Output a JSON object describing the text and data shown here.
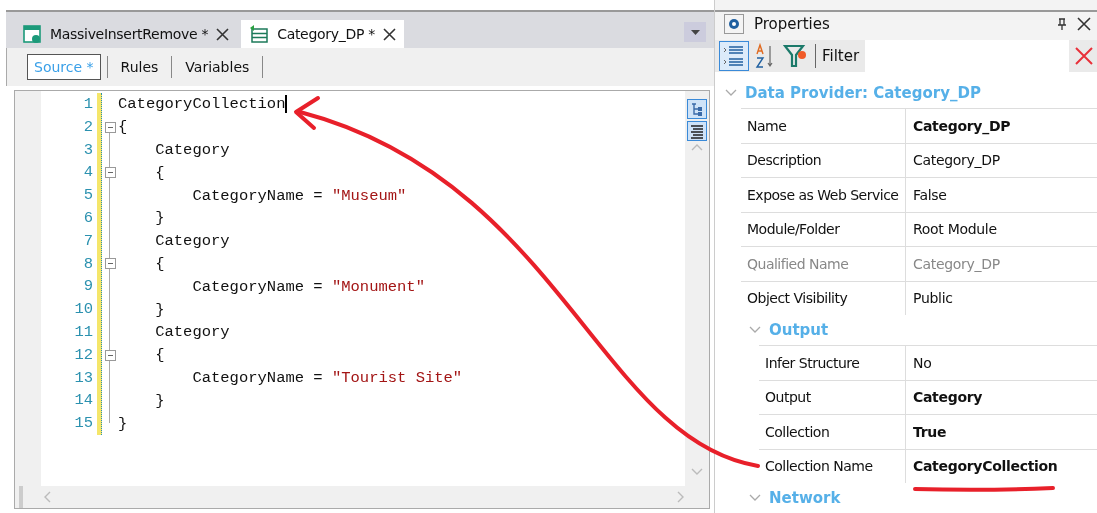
{
  "document_tabs": [
    {
      "label": "MassiveInsertRemove *",
      "selected": false,
      "kind": "procedure"
    },
    {
      "label": "Category_DP *",
      "selected": true,
      "kind": "dataprovider"
    }
  ],
  "sub_tabs": [
    {
      "label": "Source *",
      "selected": true
    },
    {
      "label": "Rules",
      "selected": false
    },
    {
      "label": "Variables",
      "selected": false
    }
  ],
  "editor": {
    "lines": [
      {
        "number": "1",
        "collapsible": false,
        "tokens": [
          {
            "kind": "plain",
            "text": "CategoryCollection"
          }
        ],
        "caret": true
      },
      {
        "number": "2",
        "collapsible": true,
        "tokens": [
          {
            "kind": "plain",
            "text": "{"
          }
        ],
        "caret": false
      },
      {
        "number": "3",
        "collapsible": false,
        "tokens": [
          {
            "kind": "plain",
            "text": "    Category"
          }
        ],
        "caret": false
      },
      {
        "number": "4",
        "collapsible": true,
        "tokens": [
          {
            "kind": "plain",
            "text": "    {"
          }
        ],
        "caret": false
      },
      {
        "number": "5",
        "collapsible": false,
        "tokens": [
          {
            "kind": "plain",
            "text": "        CategoryName = "
          },
          {
            "kind": "string",
            "text": "\"Museum\""
          }
        ],
        "caret": false
      },
      {
        "number": "6",
        "collapsible": false,
        "tokens": [
          {
            "kind": "plain",
            "text": "    }"
          }
        ],
        "caret": false
      },
      {
        "number": "7",
        "collapsible": false,
        "tokens": [
          {
            "kind": "plain",
            "text": "    Category"
          }
        ],
        "caret": false
      },
      {
        "number": "8",
        "collapsible": true,
        "tokens": [
          {
            "kind": "plain",
            "text": "    {"
          }
        ],
        "caret": false
      },
      {
        "number": "9",
        "collapsible": false,
        "tokens": [
          {
            "kind": "plain",
            "text": "        CategoryName = "
          },
          {
            "kind": "string",
            "text": "\"Monument\""
          }
        ],
        "caret": false
      },
      {
        "number": "10",
        "collapsible": false,
        "tokens": [
          {
            "kind": "plain",
            "text": "    }"
          }
        ],
        "caret": false
      },
      {
        "number": "11",
        "collapsible": false,
        "tokens": [
          {
            "kind": "plain",
            "text": "    Category"
          }
        ],
        "caret": false
      },
      {
        "number": "12",
        "collapsible": true,
        "tokens": [
          {
            "kind": "plain",
            "text": "    {"
          }
        ],
        "caret": false
      },
      {
        "number": "13",
        "collapsible": false,
        "tokens": [
          {
            "kind": "plain",
            "text": "        CategoryName = "
          },
          {
            "kind": "string",
            "text": "\"Tourist Site\""
          }
        ],
        "caret": false
      },
      {
        "number": "14",
        "collapsible": false,
        "tokens": [
          {
            "kind": "plain",
            "text": "    }"
          }
        ],
        "caret": false
      },
      {
        "number": "15",
        "collapsible": false,
        "tokens": [
          {
            "kind": "plain",
            "text": "}"
          }
        ],
        "caret": false
      }
    ]
  },
  "properties": {
    "title": "Properties",
    "filter_label": "Filter",
    "category": {
      "label": "Data Provider: Category_DP",
      "expanded": true,
      "rows": [
        {
          "name": "Name",
          "value": "Category_DP",
          "bold": true,
          "disabled": false
        },
        {
          "name": "Description",
          "value": "Category_DP",
          "bold": false,
          "disabled": false
        },
        {
          "name": "Expose as Web Service",
          "value": "False",
          "bold": false,
          "disabled": false
        },
        {
          "name": "Module/Folder",
          "value": "Root Module",
          "bold": false,
          "disabled": false
        },
        {
          "name": "Qualified Name",
          "value": "Category_DP",
          "bold": false,
          "disabled": true
        },
        {
          "name": "Object Visibility",
          "value": "Public",
          "bold": false,
          "disabled": false
        }
      ],
      "children": [
        {
          "label": "Output",
          "expanded": true,
          "rows": [
            {
              "name": "Infer Structure",
              "value": "No",
              "bold": false,
              "disabled": false
            },
            {
              "name": "Output",
              "value": "Category",
              "bold": true,
              "disabled": false
            },
            {
              "name": "Collection",
              "value": "True",
              "bold": true,
              "disabled": false
            },
            {
              "name": "Collection Name",
              "value": "CategoryCollection",
              "bold": true,
              "disabled": false
            }
          ]
        },
        {
          "label": "Network",
          "expanded": true
        }
      ]
    }
  }
}
